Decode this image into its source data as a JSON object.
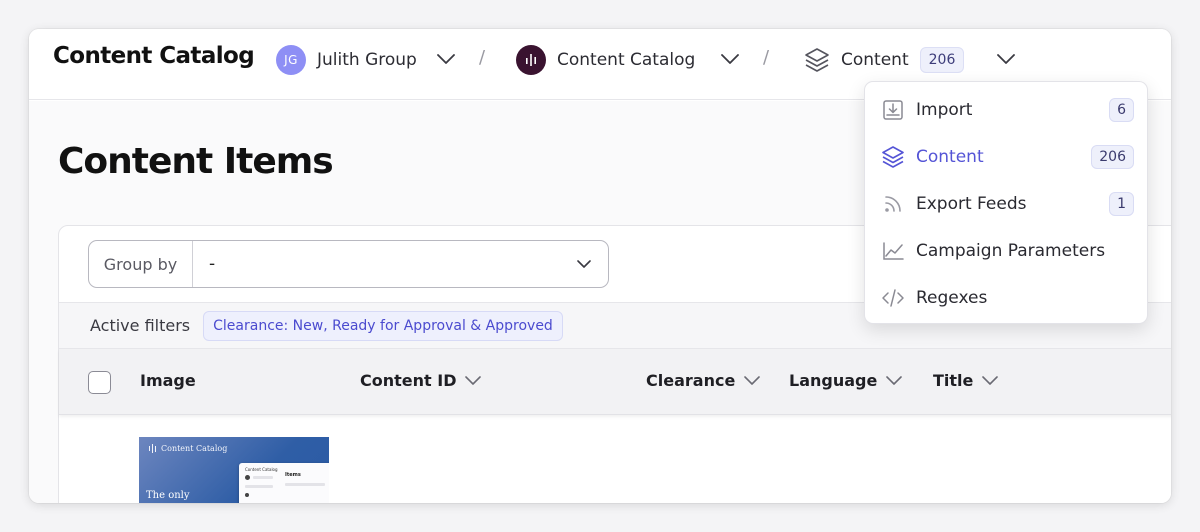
{
  "topbar": {
    "app_title": "Content Catalog",
    "breadcrumbs": [
      {
        "label": "Julith Group",
        "avatar_initials": "JG"
      },
      {
        "label": "Content Catalog"
      },
      {
        "label": "Content",
        "count": "206"
      }
    ],
    "separator": "/"
  },
  "page": {
    "title": "Content Items"
  },
  "group_by": {
    "label": "Group by",
    "value": "-"
  },
  "filters": {
    "label": "Active filters",
    "chip": "Clearance: New, Ready for Approval & Approved"
  },
  "table": {
    "columns": [
      {
        "label": "Image",
        "sortable": false
      },
      {
        "label": "Content ID",
        "sortable": true
      },
      {
        "label": "Clearance",
        "sortable": true
      },
      {
        "label": "Language",
        "sortable": true
      },
      {
        "label": "Title",
        "sortable": true
      }
    ],
    "thumbnail": {
      "brand": "Content Catalog",
      "headline": "The only",
      "mini_header": "Content Catalog",
      "mini_title": "Items"
    }
  },
  "dropdown": {
    "items": [
      {
        "label": "Import",
        "badge": "6",
        "icon": "import-icon",
        "active": false
      },
      {
        "label": "Content",
        "badge": "206",
        "icon": "layers-icon",
        "active": true
      },
      {
        "label": "Export Feeds",
        "badge": "1",
        "icon": "rss-icon",
        "active": false
      },
      {
        "label": "Campaign Parameters",
        "badge": "",
        "icon": "chart-icon",
        "active": false
      },
      {
        "label": "Regexes",
        "badge": "",
        "icon": "code-icon",
        "active": false
      }
    ]
  },
  "colors": {
    "accent": "#5454d6",
    "avatar": "#8e8ff5",
    "logo_bg": "#3a1330"
  }
}
